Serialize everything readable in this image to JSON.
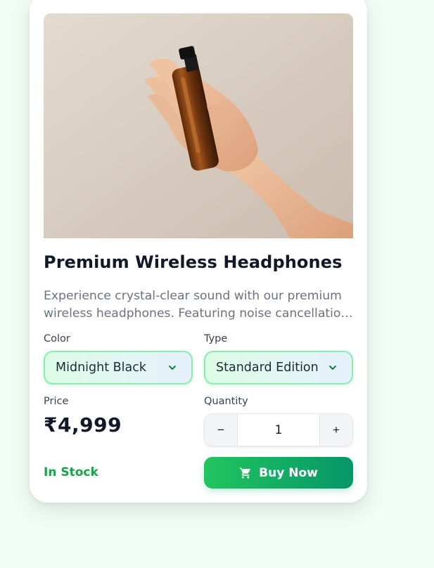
{
  "product": {
    "image_alt": "Hand holding an amber glass spray bottle",
    "title": "Premium Wireless Headphones",
    "description": "Experience crystal-clear sound with our premium wireless headphones. Featuring noise cancellation technology and long battery life.",
    "color_label": "Color",
    "color_value": "Midnight Black",
    "type_label": "Type",
    "type_value": "Standard Edition",
    "price_label": "Price",
    "price": "₹4,999",
    "quantity_label": "Quantity",
    "quantity_value": "1",
    "decrement": "−",
    "increment": "+",
    "stock_status": "In Stock",
    "buy_label": "Buy Now"
  },
  "icons": {
    "select_chevron": "chevron-down-icon",
    "buy": "shopping-cart-icon"
  },
  "colors": {
    "page_bg": "#f0fdf4",
    "accent_green": "#22c55e",
    "accent_dark_green": "#059669",
    "stock_green": "#16a34a",
    "select_border": "#86efac"
  }
}
